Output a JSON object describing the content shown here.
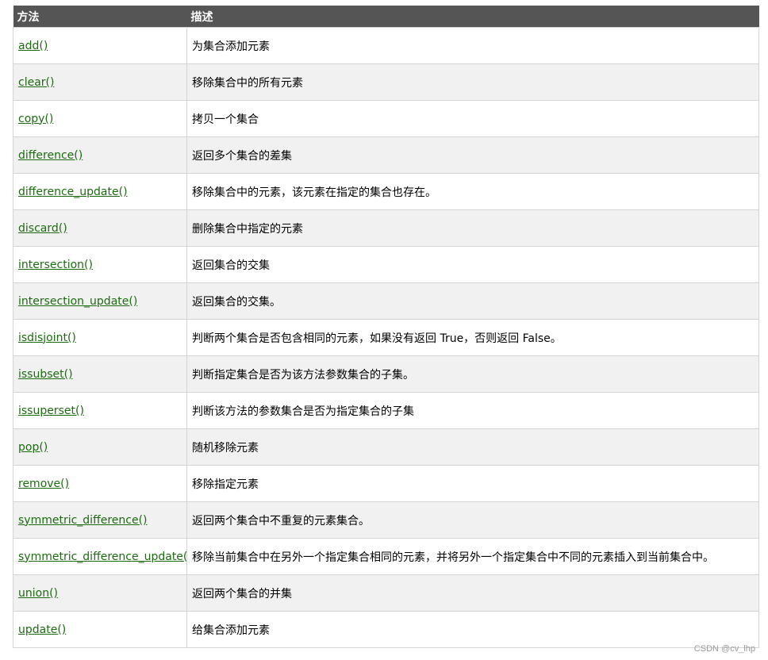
{
  "table": {
    "headers": [
      "方法",
      "描述"
    ],
    "rows": [
      {
        "method": "add()",
        "description": "为集合添加元素"
      },
      {
        "method": "clear()",
        "description": "移除集合中的所有元素"
      },
      {
        "method": "copy()",
        "description": "拷贝一个集合"
      },
      {
        "method": "difference()",
        "description": "返回多个集合的差集"
      },
      {
        "method": "difference_update()",
        "description": "移除集合中的元素，该元素在指定的集合也存在。"
      },
      {
        "method": "discard()",
        "description": "删除集合中指定的元素"
      },
      {
        "method": "intersection()",
        "description": "返回集合的交集"
      },
      {
        "method": "intersection_update()",
        "description": "返回集合的交集。"
      },
      {
        "method": "isdisjoint()",
        "description": "判断两个集合是否包含相同的元素，如果没有返回 True，否则返回 False。"
      },
      {
        "method": "issubset()",
        "description": "判断指定集合是否为该方法参数集合的子集。"
      },
      {
        "method": "issuperset()",
        "description": "判断该方法的参数集合是否为指定集合的子集"
      },
      {
        "method": "pop()",
        "description": "随机移除元素"
      },
      {
        "method": "remove()",
        "description": "移除指定元素"
      },
      {
        "method": "symmetric_difference()",
        "description": "返回两个集合中不重复的元素集合。"
      },
      {
        "method": "symmetric_difference_update()",
        "description": "移除当前集合中在另外一个指定集合相同的元素，并将另外一个指定集合中不同的元素插入到当前集合中。"
      },
      {
        "method": "union()",
        "description": "返回两个集合的并集"
      },
      {
        "method": "update()",
        "description": "给集合添加元素"
      }
    ]
  },
  "watermark": "CSDN @cv_lhp",
  "colors": {
    "header_bg": "#555555",
    "link": "#1d6b11",
    "stripe": "#f1f1f1",
    "border": "#d4d4d4"
  }
}
